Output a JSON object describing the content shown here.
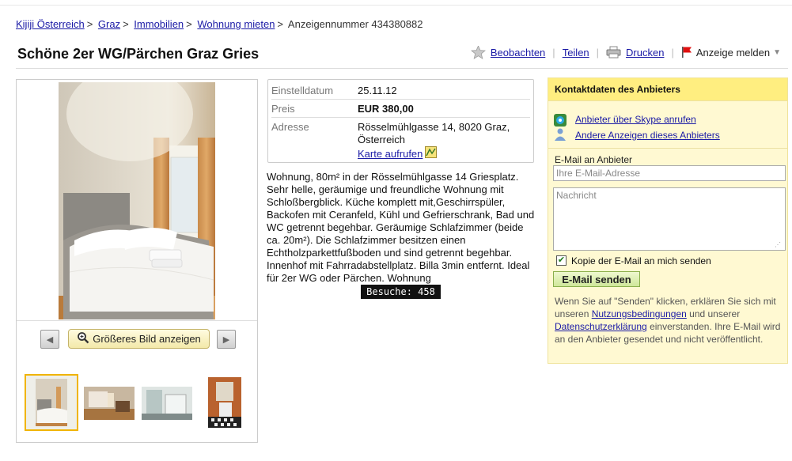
{
  "breadcrumb": {
    "items": [
      "Kijiji Österreich",
      "Graz",
      "Immobilien",
      "Wohnung mieten"
    ],
    "current": "Anzeigennummer 434380882",
    "separator": ">"
  },
  "title": "Schöne 2er WG/Pärchen Graz Gries",
  "actions": {
    "watch": "Beobachten",
    "share": "Teilen",
    "print": "Drucken",
    "report": "Anzeige melden",
    "divider": "|"
  },
  "gallery": {
    "bigger_button": "Größeres Bild anzeigen",
    "prev_arrow": "◀",
    "next_arrow": "▶"
  },
  "details": {
    "date_label": "Einstelldatum",
    "date_value": "25.11.12",
    "price_label": "Preis",
    "price_value": "EUR 380,00",
    "address_label": "Adresse",
    "address_line1": "Rösselmühlgasse 14, 8020 Graz,",
    "address_line2": "Österreich",
    "map_link": "Karte aufrufen"
  },
  "description": "Wohnung, 80m² in der Rösselmühlgasse 14 Griesplatz. Sehr helle, geräumige und freundliche Wohnung mit Schloßbergblick. Küche komplett mit,Geschirrspüler, Backofen mit Ceranfeld, Kühl und Gefrierschrank, Bad und WC getrennt begehbar. Geräumige Schlafzimmer (beide ca. 20m²). Die Schlafzimmer besitzen einen Echtholzparkettfußboden und sind getrennt begehbar. Innenhof mit Fahrradabstellplatz. Billa 3min entfernt. Ideal für 2er WG oder Pärchen. Wohnung",
  "visits": "Besuche: 458",
  "contact": {
    "heading": "Kontaktdaten des Anbieters",
    "skype_link": "Anbieter über Skype anrufen",
    "other_ads_link": "Andere Anzeigen dieses Anbieters",
    "email_label": "E-Mail an Anbieter",
    "email_placeholder": "Ihre E-Mail-Adresse",
    "message_placeholder": "Nachricht",
    "copy_label": "Kopie der E-Mail an mich senden",
    "copy_checked": true,
    "send_button": "E-Mail senden",
    "note_before": "Wenn Sie auf \"Senden\" klicken, erklären Sie sich mit unseren ",
    "terms_link": "Nutzungsbedingungen",
    "note_middle": " und unserer ",
    "privacy_link": "Datenschutzerklärung",
    "note_after": " einverstanden. Ihre E-Mail wird an den Anbieter gesendet und nicht veröffentlicht."
  },
  "colors": {
    "link": "#1a1aa6",
    "contact_bg": "#fff9d2",
    "contact_header": "#ffee80",
    "thumb_selected_border": "#f0b400"
  },
  "icons": [
    "star-icon",
    "printer-icon",
    "flag-icon",
    "magnifier-icon",
    "map-icon",
    "skype-icon",
    "person-icon",
    "checkmark-icon"
  ]
}
